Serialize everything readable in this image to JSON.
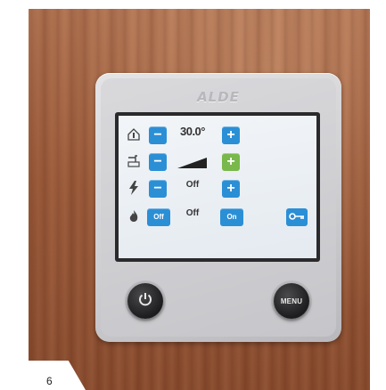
{
  "brand": "ALDE",
  "page_number": "6",
  "rows": [
    {
      "icon": "house-thermometer-icon",
      "minus": "−",
      "value": "30.0°",
      "plus": "+"
    },
    {
      "icon": "tap-icon",
      "minus": "−",
      "value": "",
      "plus": "+"
    },
    {
      "icon": "lightning-icon",
      "minus": "−",
      "value": "Off",
      "plus": "+"
    },
    {
      "icon": "flame-icon",
      "left_toggle": "Off",
      "value": "Off",
      "right_toggle": "On"
    }
  ],
  "buttons": {
    "power": "power-icon",
    "menu": "MENU",
    "key": "key-icon"
  },
  "colors": {
    "button_blue": "#2b8fd6",
    "button_green": "#79b84a",
    "screen": "#eef2f6"
  }
}
